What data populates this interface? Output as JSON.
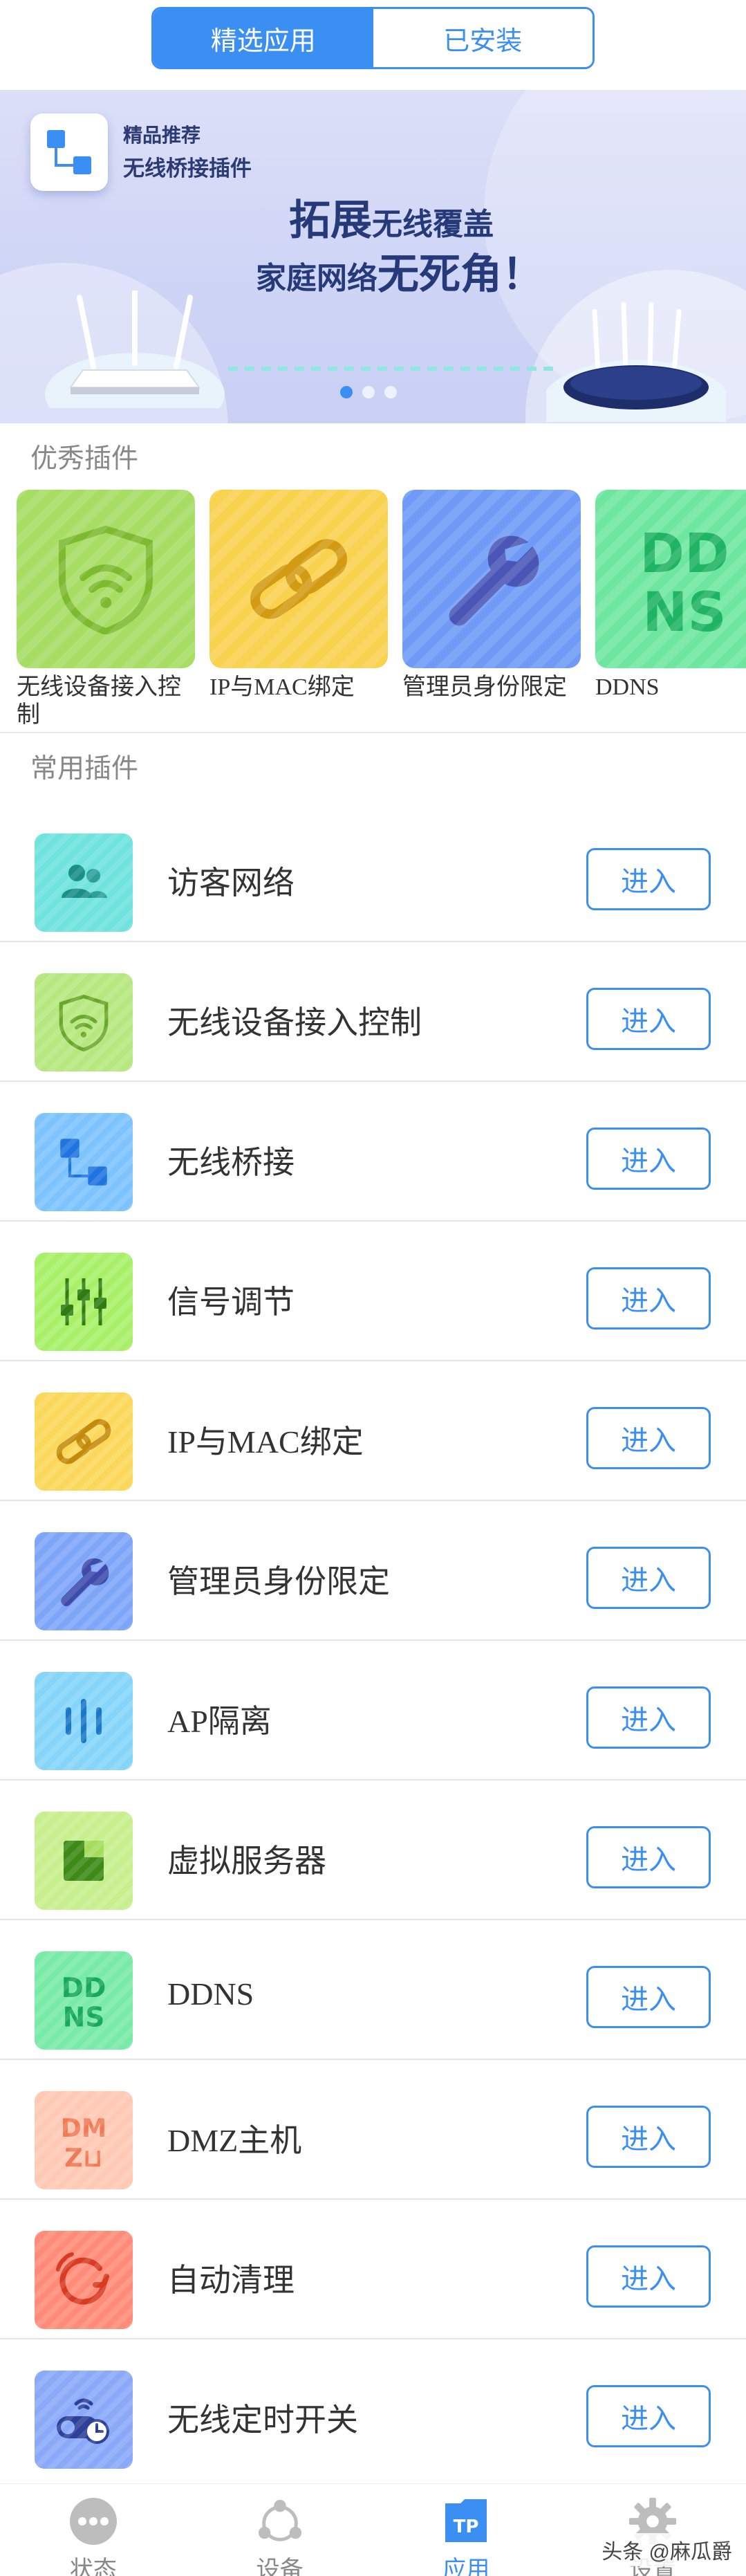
{
  "tabs": [
    {
      "label": "精选应用",
      "active": true
    },
    {
      "label": "已安装",
      "active": false
    }
  ],
  "banner": {
    "tag": "精品推荐",
    "name": "无线桥接插件",
    "line1_bold": "拓展",
    "line1_rest": "无线覆盖",
    "line2_rest": "家庭网络",
    "line2_bold": "无死角！",
    "page_count": 3,
    "current_page": 1
  },
  "featured": {
    "title": "优秀插件",
    "items": [
      {
        "label": "无线设备接入控制",
        "icon": "wifi-shield-icon",
        "color": "#a6dd63"
      },
      {
        "label": "IP与MAC绑定",
        "icon": "link-icon",
        "color": "#f9d24e"
      },
      {
        "label": "管理员身份限定",
        "icon": "wrench-icon",
        "color": "#6f9bf6"
      },
      {
        "label": "DDNS",
        "icon": "ddns-icon",
        "color": "#6ee6a0"
      }
    ]
  },
  "common": {
    "title": "常用插件",
    "button_label": "进入",
    "items": [
      {
        "label": "访客网络",
        "icon": "guest-users-icon",
        "color": "#6fe3de"
      },
      {
        "label": "无线设备接入控制",
        "icon": "wifi-shield-icon",
        "color": "#b7e77f"
      },
      {
        "label": "无线桥接",
        "icon": "bridge-icon",
        "color": "#7cc3ff"
      },
      {
        "label": "信号调节",
        "icon": "signal-adjust-icon",
        "color": "#a9f069"
      },
      {
        "label": "IP与MAC绑定",
        "icon": "link-icon",
        "color": "#fbd85a"
      },
      {
        "label": "管理员身份限定",
        "icon": "wrench-icon",
        "color": "#7ea6f8"
      },
      {
        "label": "AP隔离",
        "icon": "ap-isolation-icon",
        "color": "#85d5fb"
      },
      {
        "label": "虚拟服务器",
        "icon": "virtual-server-icon",
        "color": "#c7ef8e"
      },
      {
        "label": "DDNS",
        "icon": "ddns-icon",
        "color": "#79eba8"
      },
      {
        "label": "DMZ主机",
        "icon": "dmz-icon",
        "color": "#ffc9b4"
      },
      {
        "label": "自动清理",
        "icon": "auto-clean-icon",
        "color": "#ff8b78"
      },
      {
        "label": "无线定时开关",
        "icon": "wifi-timer-icon",
        "color": "#8aa9f9"
      }
    ]
  },
  "bottom_nav": [
    {
      "label": "状态",
      "icon": "status-icon",
      "active": false
    },
    {
      "label": "设备",
      "icon": "devices-icon",
      "active": false
    },
    {
      "label": "应用",
      "icon": "tp-apps-icon",
      "active": true
    },
    {
      "label": "设置",
      "icon": "gear-icon",
      "active": false
    }
  ],
  "watermark": "头条 @麻瓜爵"
}
